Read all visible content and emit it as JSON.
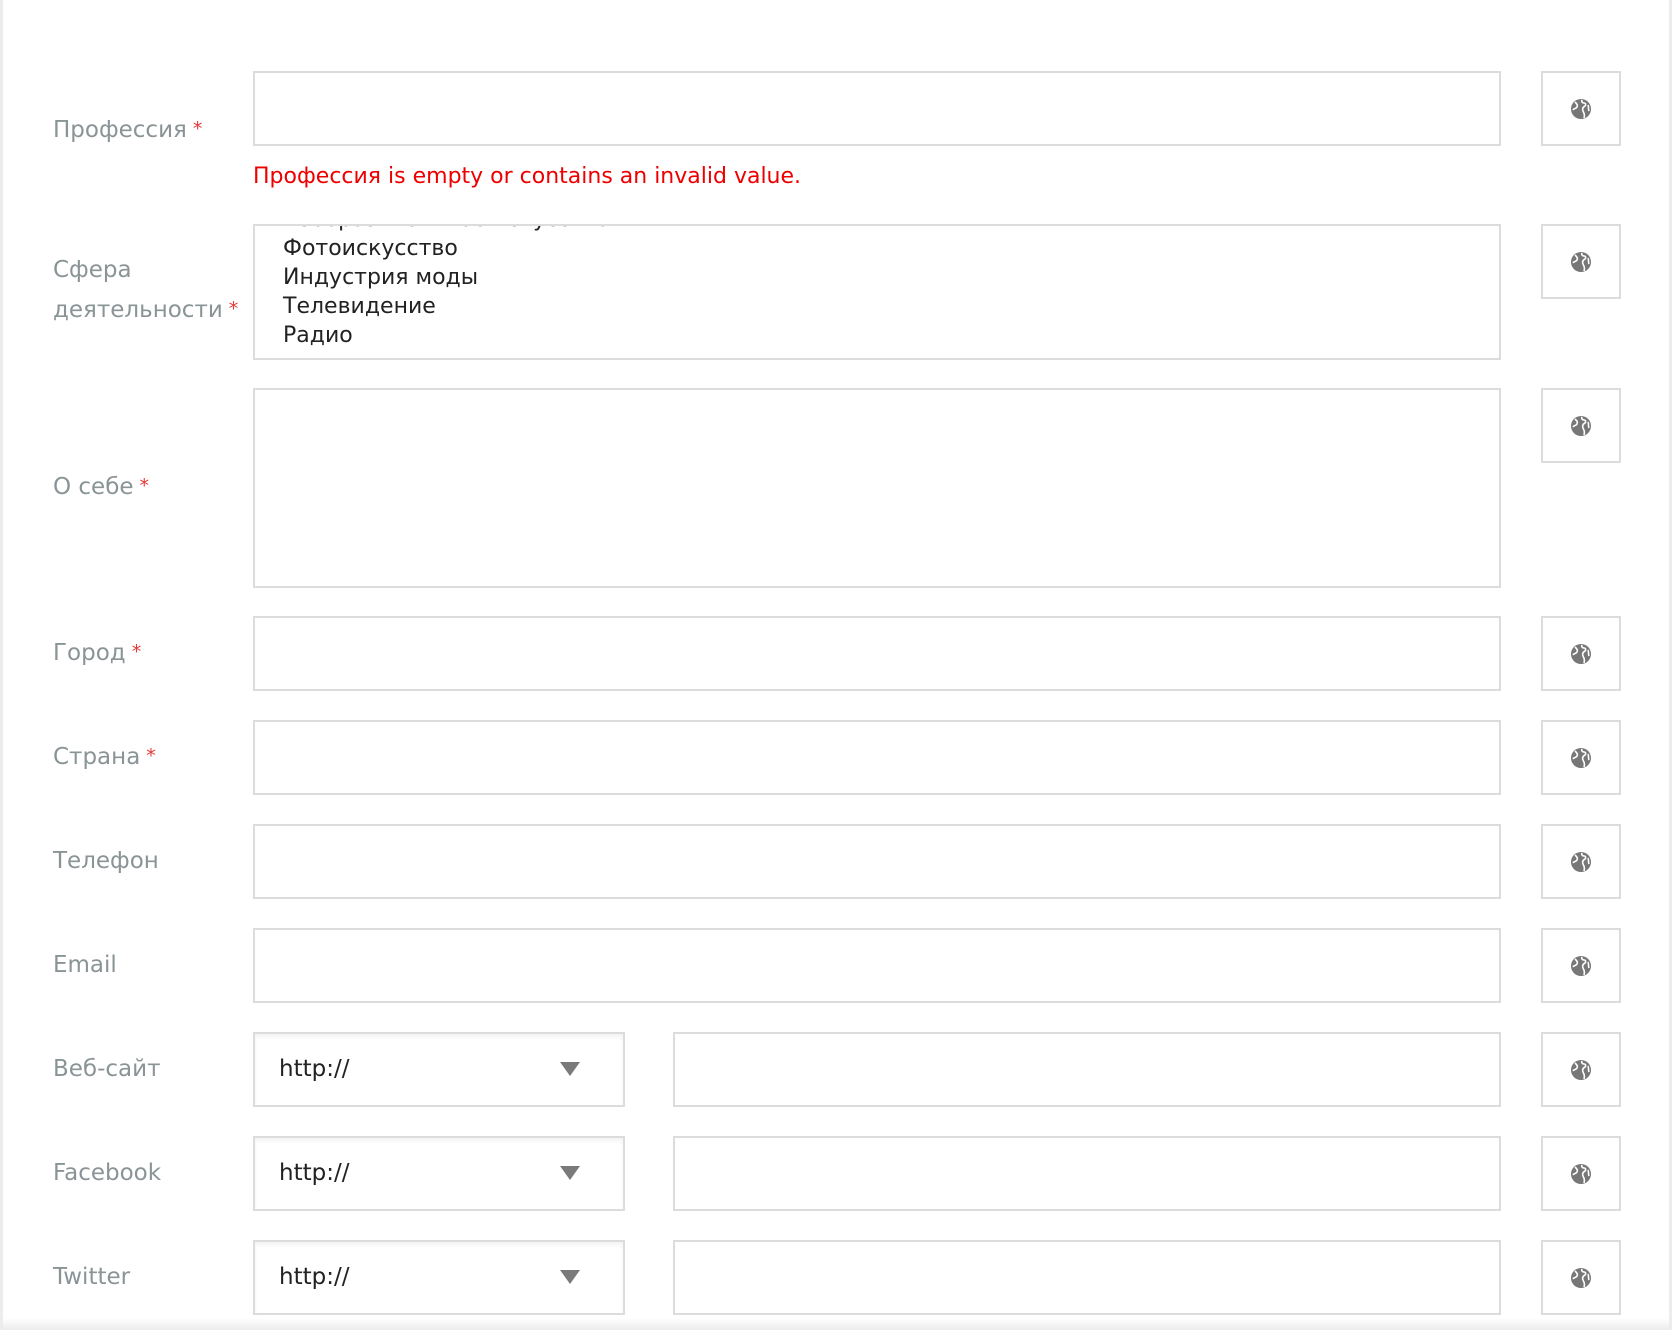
{
  "colors": {
    "label": "#8a9496",
    "required": "#e53935",
    "error": "#ee0000",
    "border": "#dcdcdc"
  },
  "required_mark": "*",
  "fields": {
    "profession": {
      "label": "Профессия",
      "value": "",
      "error": "Профессия is empty or contains an invalid value."
    },
    "sphere": {
      "label_line1": "Сфера",
      "label_line2": "деятельности",
      "options": [
        "Изобразительное искусство",
        "Фотоискусство",
        "Индустрия моды",
        "Телевидение",
        "Радио"
      ]
    },
    "about": {
      "label": "О себе",
      "value": ""
    },
    "city": {
      "label": "Город",
      "value": ""
    },
    "country": {
      "label": "Страна",
      "value": ""
    },
    "phone": {
      "label": "Телефон",
      "value": ""
    },
    "email": {
      "label": "Email",
      "value": ""
    },
    "website": {
      "label": "Веб-сайт",
      "protocol": "http://",
      "value": ""
    },
    "facebook": {
      "label": "Facebook",
      "protocol": "http://",
      "value": ""
    },
    "twitter": {
      "label": "Twitter",
      "protocol": "http://",
      "value": ""
    }
  },
  "icons": {
    "visibility": "globe-icon",
    "dropdown": "caret-down-icon"
  }
}
